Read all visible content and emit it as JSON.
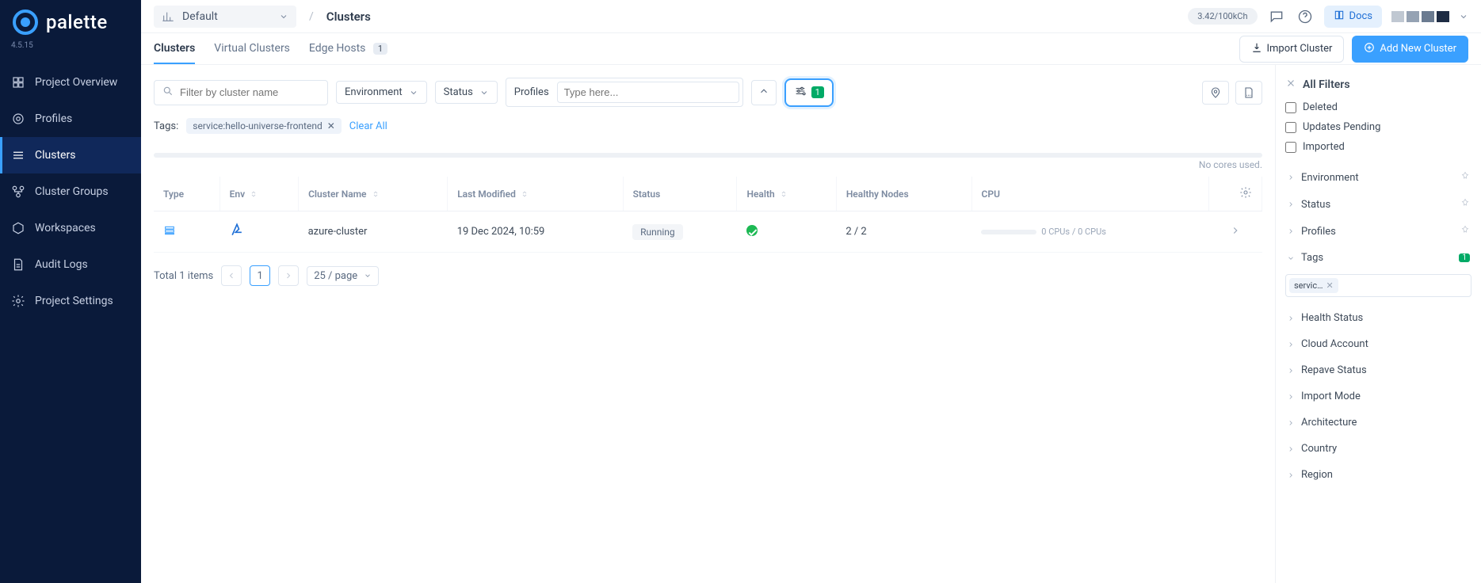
{
  "logo_text": "palette",
  "version": "4.5.15",
  "sidebar": {
    "items": [
      {
        "label": "Project Overview",
        "active": false
      },
      {
        "label": "Profiles",
        "active": false
      },
      {
        "label": "Clusters",
        "active": true
      },
      {
        "label": "Cluster Groups",
        "active": false
      },
      {
        "label": "Workspaces",
        "active": false
      },
      {
        "label": "Audit Logs",
        "active": false
      },
      {
        "label": "Project Settings",
        "active": false
      }
    ]
  },
  "topbar": {
    "scope_label": "Default",
    "breadcrumb_current": "Clusters",
    "usage_text": "3.42/100kCh",
    "docs_label": "Docs",
    "swatch_colors": [
      "#c0c8d2",
      "#95a2b3",
      "#6b7b90",
      "#1e2c44"
    ]
  },
  "tabs": [
    {
      "label": "Clusters",
      "active": true,
      "badge": null
    },
    {
      "label": "Virtual Clusters",
      "active": false,
      "badge": null
    },
    {
      "label": "Edge Hosts",
      "active": false,
      "badge": "1"
    }
  ],
  "tabs_actions": {
    "import_label": "Import Cluster",
    "add_label": "Add New Cluster"
  },
  "filter_bar": {
    "search_placeholder": "Filter by cluster name",
    "env_label": "Environment",
    "status_label": "Status",
    "profiles_label": "Profiles",
    "profiles_input_placeholder": "Type here...",
    "active_filter_count": "1"
  },
  "tags_row": {
    "label": "Tags:",
    "chip_text": "service:hello-universe-frontend",
    "clear_label": "Clear All"
  },
  "cores_note": "No cores used.",
  "table": {
    "columns": [
      "Type",
      "Env",
      "Cluster Name",
      "Last Modified",
      "Status",
      "Health",
      "Healthy Nodes",
      "CPU"
    ],
    "rows": [
      {
        "cluster_name": "azure-cluster",
        "last_modified": "19 Dec 2024, 10:59",
        "status": "Running",
        "healthy_nodes": "2 / 2",
        "cpu_text": "0 CPUs / 0 CPUs"
      }
    ]
  },
  "pagination": {
    "total_label": "Total 1 items",
    "current_page": "1",
    "page_size_label": "25 / page"
  },
  "filters_panel": {
    "title": "All Filters",
    "checkboxes": [
      "Deleted",
      "Updates Pending",
      "Imported"
    ],
    "groups_pinned": [
      "Environment",
      "Status",
      "Profiles"
    ],
    "tags_group_label": "Tags",
    "tags_group_count": "1",
    "tags_chip": "servic…",
    "groups_rest": [
      "Health Status",
      "Cloud Account",
      "Repave Status",
      "Import Mode",
      "Architecture",
      "Country",
      "Region"
    ]
  }
}
